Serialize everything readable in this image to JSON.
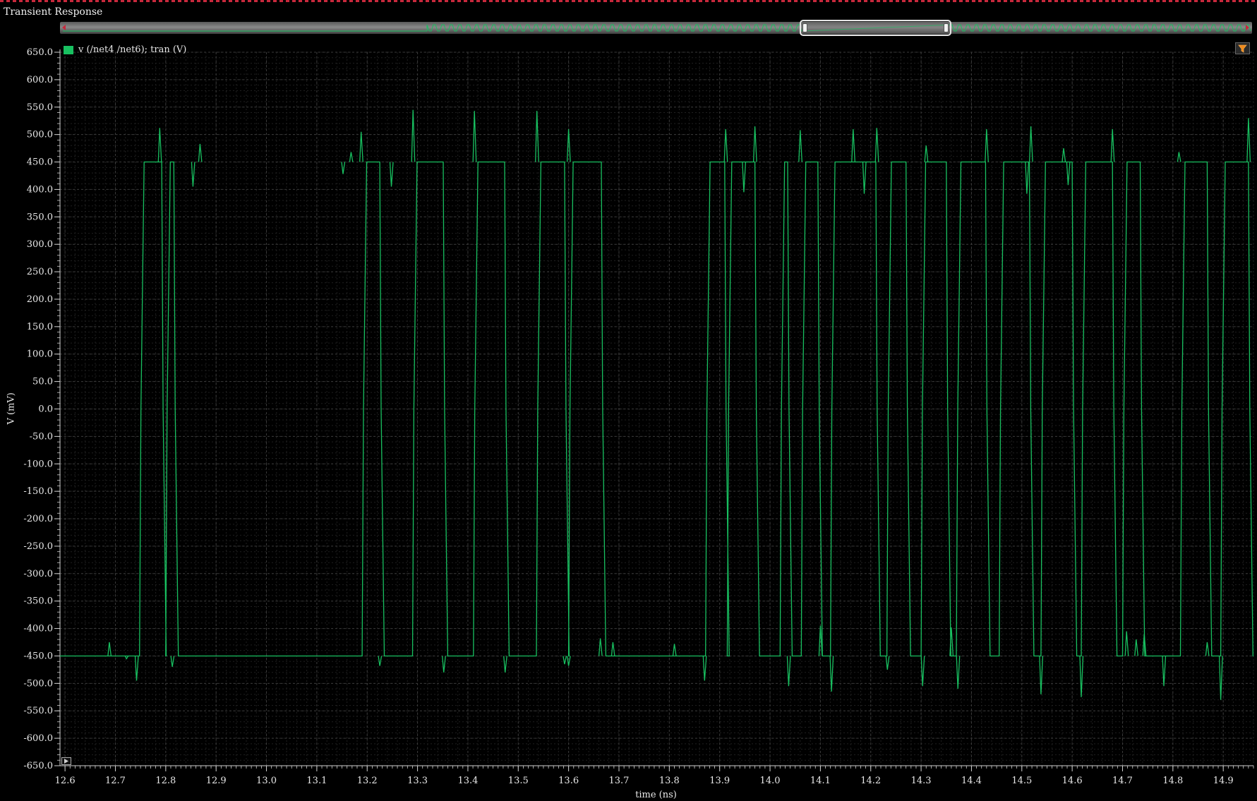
{
  "window": {
    "title": "Transient Response"
  },
  "colors": {
    "trace": "#18c060",
    "grid": "#3a3a3a",
    "axis": "#d0d0d0",
    "background": "#000000"
  },
  "legend": {
    "label": "v (/net4 /net6); tran (V)",
    "swatch_color": "#18c060"
  },
  "toolbar": {
    "filter_icon": "filter-icon",
    "expand_icon": "expand-arrow-icon"
  },
  "overview": {
    "visible_range_ns": [
      12.6,
      14.95
    ],
    "full_range_fraction": [
      0.62,
      0.74
    ]
  },
  "chart_data": {
    "type": "line",
    "xlabel": "time (ns)",
    "ylabel": "V (mV)",
    "xlim": [
      12.59,
      14.96
    ],
    "ylim": [
      -650,
      650
    ],
    "grid": true,
    "legend_position": "top-left",
    "x_ticks": [
      "12.6",
      "12.7",
      "12.8",
      "12.9",
      "13.0",
      "13.1",
      "13.2",
      "13.3",
      "13.4",
      "13.5",
      "13.6",
      "13.7",
      "13.8",
      "13.9",
      "14.0",
      "14.1",
      "14.2",
      "14.3",
      "14.4",
      "14.5",
      "14.6",
      "14.7",
      "14.8",
      "14.9"
    ],
    "y_ticks": [
      "650.0",
      "600.0",
      "550.0",
      "500.0",
      "450.0",
      "400.0",
      "350.0",
      "300.0",
      "250.0",
      "200.0",
      "150.0",
      "100.0",
      "50.0",
      "0.0",
      "-50.0",
      "-100.0",
      "-150.0",
      "-200.0",
      "-250.0",
      "-300.0",
      "-350.0",
      "-400.0",
      "-450.0",
      "-500.0",
      "-550.0",
      "-600.0",
      "-650.0"
    ],
    "series": [
      {
        "name": "v (/net4 /net6); tran (V)",
        "color": "#18c060",
        "low_mV": -450,
        "high_mV": 450,
        "transitions_ns": [
          12.748,
          12.792,
          12.8,
          12.816,
          13.19,
          13.225,
          13.29,
          13.351,
          13.411,
          13.473,
          13.536,
          13.592,
          13.6,
          13.665,
          13.872,
          13.91,
          13.915,
          13.97,
          14.02,
          14.035,
          14.062,
          14.095,
          14.12,
          14.21,
          14.232,
          14.27,
          14.3,
          14.35,
          14.37,
          14.428,
          14.455,
          14.515,
          14.538,
          14.6,
          14.618,
          14.68,
          14.7,
          14.735,
          14.815,
          14.868,
          14.895,
          14.95
        ],
        "spikes": [
          {
            "t": 12.688,
            "mV": -425
          },
          {
            "t": 12.722,
            "mV": -455
          },
          {
            "t": 12.742,
            "mV": -495
          },
          {
            "t": 12.788,
            "mV": 512
          },
          {
            "t": 12.813,
            "mV": -470
          },
          {
            "t": 12.854,
            "mV": 405
          },
          {
            "t": 12.868,
            "mV": 483
          },
          {
            "t": 13.152,
            "mV": 428
          },
          {
            "t": 13.168,
            "mV": 468
          },
          {
            "t": 13.188,
            "mV": 505
          },
          {
            "t": 13.225,
            "mV": -468
          },
          {
            "t": 13.248,
            "mV": 405
          },
          {
            "t": 13.291,
            "mV": 545
          },
          {
            "t": 13.352,
            "mV": -480
          },
          {
            "t": 13.413,
            "mV": 543
          },
          {
            "t": 13.474,
            "mV": -480
          },
          {
            "t": 13.537,
            "mV": 543
          },
          {
            "t": 13.592,
            "mV": -465
          },
          {
            "t": 13.6,
            "mV": -468
          },
          {
            "t": 13.6,
            "mV": 510
          },
          {
            "t": 13.663,
            "mV": -418
          },
          {
            "t": 13.688,
            "mV": -425
          },
          {
            "t": 13.81,
            "mV": -428
          },
          {
            "t": 13.87,
            "mV": -495
          },
          {
            "t": 13.912,
            "mV": 510
          },
          {
            "t": 13.948,
            "mV": 395
          },
          {
            "t": 13.97,
            "mV": 515
          },
          {
            "t": 14.037,
            "mV": -505
          },
          {
            "t": 14.06,
            "mV": 508
          },
          {
            "t": 14.1,
            "mV": -395
          },
          {
            "t": 14.122,
            "mV": -515
          },
          {
            "t": 14.165,
            "mV": 510
          },
          {
            "t": 14.187,
            "mV": 392
          },
          {
            "t": 14.212,
            "mV": 512
          },
          {
            "t": 14.233,
            "mV": -475
          },
          {
            "t": 14.303,
            "mV": -505
          },
          {
            "t": 14.31,
            "mV": 480
          },
          {
            "t": 14.36,
            "mV": -398
          },
          {
            "t": 14.373,
            "mV": -510
          },
          {
            "t": 14.43,
            "mV": 510
          },
          {
            "t": 14.51,
            "mV": 392
          },
          {
            "t": 14.518,
            "mV": 515
          },
          {
            "t": 14.538,
            "mV": -520
          },
          {
            "t": 14.583,
            "mV": 475
          },
          {
            "t": 14.592,
            "mV": 408
          },
          {
            "t": 14.618,
            "mV": -525
          },
          {
            "t": 14.68,
            "mV": 510
          },
          {
            "t": 14.708,
            "mV": -405
          },
          {
            "t": 14.727,
            "mV": -420
          },
          {
            "t": 14.743,
            "mV": -410
          },
          {
            "t": 14.782,
            "mV": -505
          },
          {
            "t": 14.812,
            "mV": 468
          },
          {
            "t": 14.868,
            "mV": -425
          },
          {
            "t": 14.895,
            "mV": -530
          },
          {
            "t": 14.95,
            "mV": 530
          }
        ]
      }
    ]
  }
}
